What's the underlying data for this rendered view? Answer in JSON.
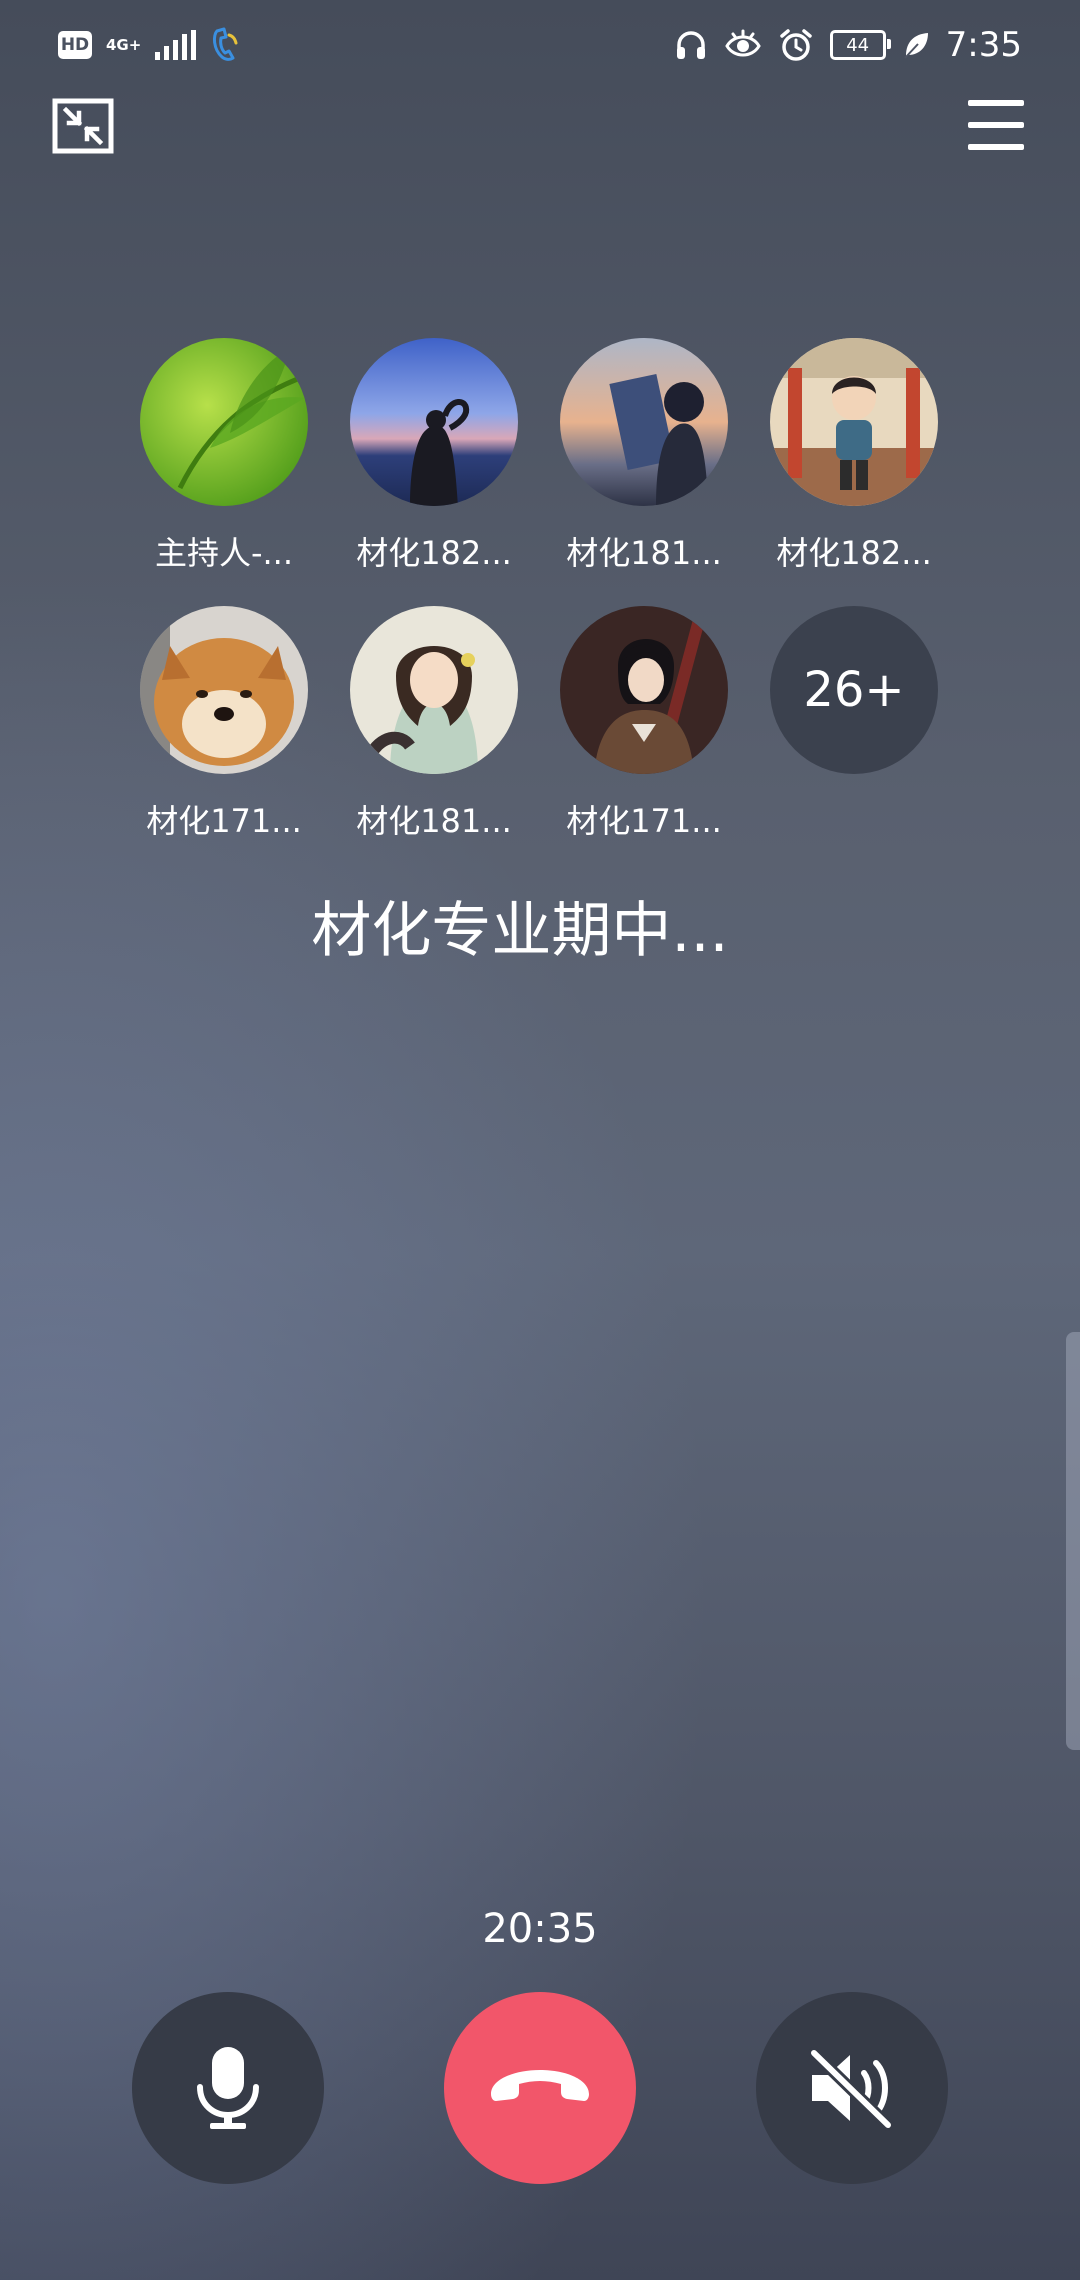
{
  "status_bar": {
    "hd_label": "HD",
    "network_label": "4G+",
    "battery_level": "44",
    "time": "7:35",
    "icons": [
      "hd-icon",
      "signal-icon",
      "call-icon",
      "headphones-icon",
      "eye-icon",
      "alarm-icon",
      "battery-icon",
      "leaf-icon"
    ]
  },
  "participants": [
    {
      "name": "主持人-...",
      "avatar": "green-leaf"
    },
    {
      "name": "材化182...",
      "avatar": "sunset-lake-girl"
    },
    {
      "name": "材化181...",
      "avatar": "painting-girl"
    },
    {
      "name": "材化182...",
      "avatar": "anime-boy-train"
    },
    {
      "name": "材化171...",
      "avatar": "shiba-dog"
    },
    {
      "name": "材化181...",
      "avatar": "anime-girl-flower"
    },
    {
      "name": "材化171...",
      "avatar": "dark-hair-boy"
    }
  ],
  "more_count": "26+",
  "meeting_title": "材化专业期中...",
  "call_timer": "20:35",
  "controls": {
    "mic": "mic-icon",
    "hangup": "hangup-icon",
    "speaker": "speaker-muted-icon"
  },
  "colors": {
    "hangup": "#f2566a",
    "control_bg": "#363b47",
    "more_badge_bg": "#3b414e"
  }
}
